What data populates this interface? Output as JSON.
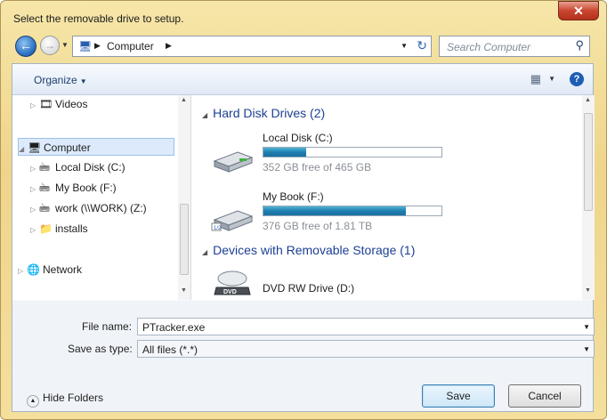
{
  "window": {
    "title": "Select the removable drive to setup.",
    "close_glyph": "✕"
  },
  "nav": {
    "back_icon": "back-arrow-icon",
    "forward_icon": "forward-arrow-icon",
    "address": {
      "crumb": "Computer"
    },
    "search_placeholder": "Search Computer"
  },
  "toolbar": {
    "organize_label": "Organize",
    "help_glyph": "?"
  },
  "tree": {
    "items": [
      {
        "label": "Videos",
        "icon": "videos-icon"
      },
      {
        "label": "Computer",
        "icon": "computer-icon",
        "selected": true
      },
      {
        "label": "Local Disk (C:)",
        "icon": "local-disk-icon"
      },
      {
        "label": "My Book (F:)",
        "icon": "usb-drive-icon"
      },
      {
        "label": "work (\\\\WORK) (Z:)",
        "icon": "network-drive-icon"
      },
      {
        "label": "installs",
        "icon": "folder-icon"
      },
      {
        "label": "Network",
        "icon": "network-icon"
      }
    ]
  },
  "main": {
    "groups": [
      {
        "label": "Hard Disk Drives (2)"
      },
      {
        "label": "Devices with Removable Storage (1)"
      }
    ],
    "drives": [
      {
        "name": "Local Disk (C:)",
        "free": "352 GB free of 465 GB",
        "used_fraction": 0.24
      },
      {
        "name": "My Book (F:)",
        "free": "376 GB free of 1.81 TB",
        "used_fraction": 0.8
      },
      {
        "name": "DVD RW Drive (D:)"
      }
    ]
  },
  "form": {
    "file_name_label": "File name:",
    "file_name_value": "PTracker.exe",
    "save_type_label": "Save as type:",
    "save_type_value": "All files (*.*)"
  },
  "footer": {
    "hide_folders_label": "Hide Folders",
    "save_label": "Save",
    "cancel_label": "Cancel"
  },
  "colors": {
    "accent": "#1c3f94",
    "bar_fill": "#1f7fb0",
    "title_bar": "#efd58b"
  }
}
